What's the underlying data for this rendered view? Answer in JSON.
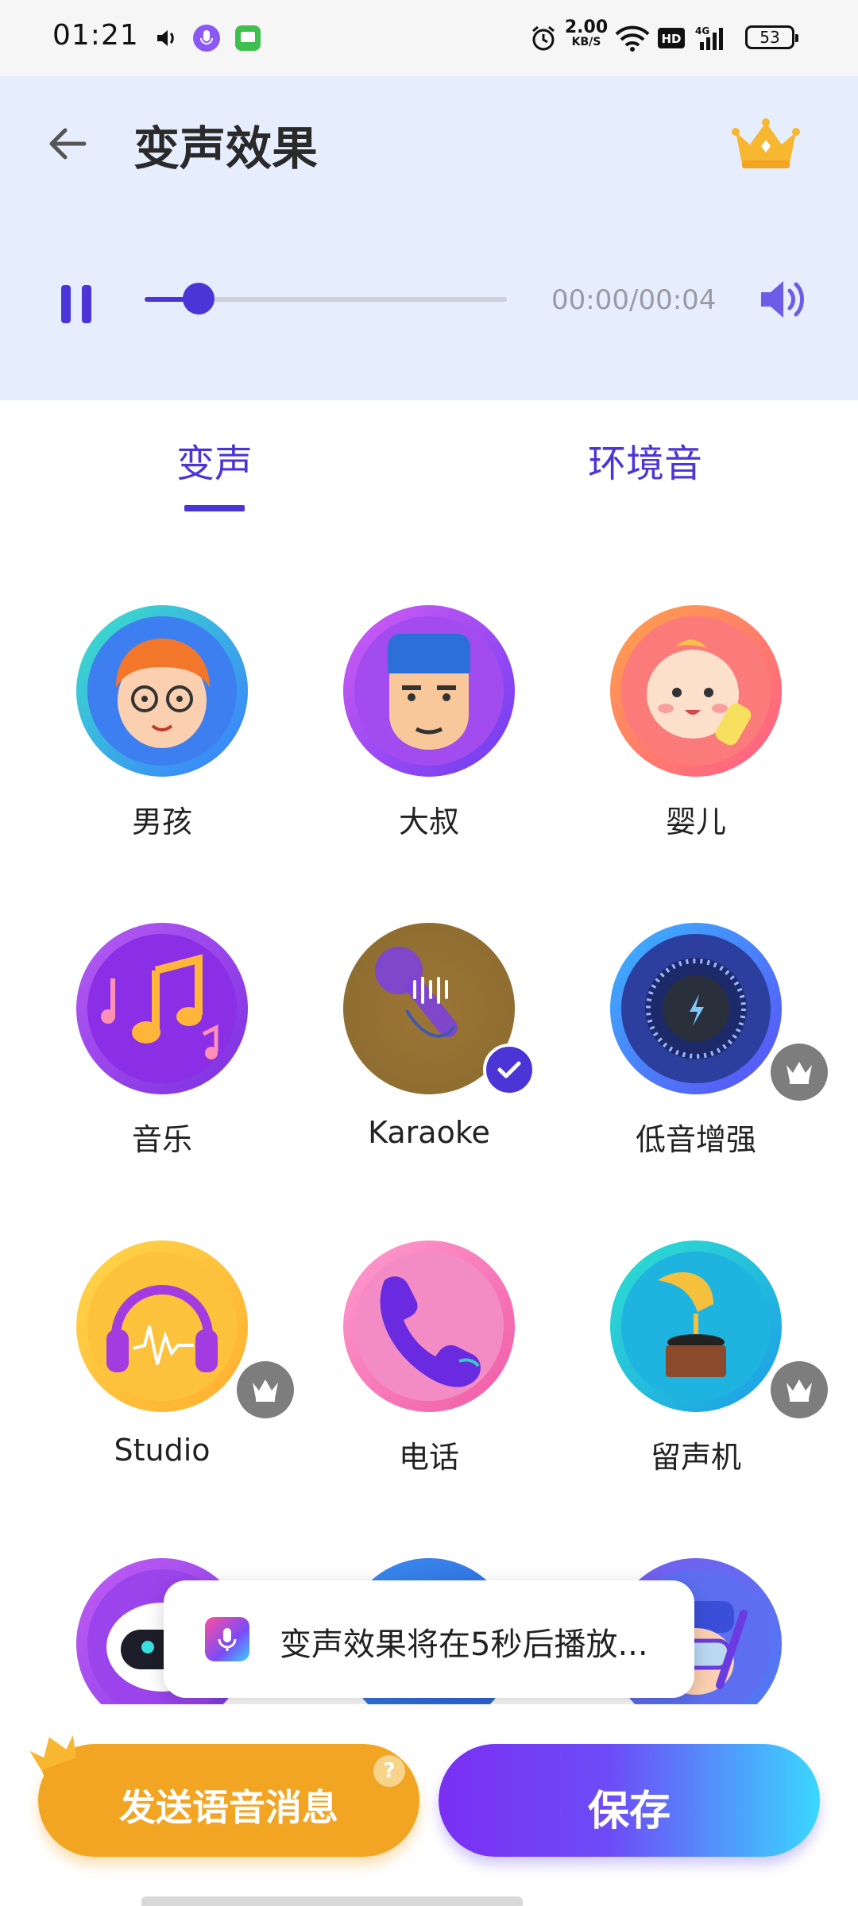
{
  "status_bar": {
    "time": "01:21",
    "net_speed_value": "2.00",
    "net_speed_unit": "KB/S",
    "battery": "53",
    "icons": [
      "volume-icon",
      "voice-app-icon",
      "message-app-icon",
      "alarm-icon",
      "wifi-icon",
      "hd-icon",
      "signal-4g-icon",
      "battery-icon"
    ]
  },
  "header": {
    "title": "变声效果",
    "back_icon": "arrow-left-icon",
    "vip_icon": "crown-icon",
    "player": {
      "state_icon": "pause-icon",
      "time": "00:00/00:04",
      "progress_fraction": 0.15,
      "volume_icon": "speaker-icon"
    }
  },
  "tabs": [
    {
      "label": "变声",
      "selected": true
    },
    {
      "label": "环境音",
      "selected": false
    }
  ],
  "effects": [
    {
      "label": "男孩",
      "icon": "boy-avatar-icon"
    },
    {
      "label": "大叔",
      "icon": "uncle-avatar-icon"
    },
    {
      "label": "婴儿",
      "icon": "baby-avatar-icon"
    },
    {
      "label": "音乐",
      "icon": "music-notes-icon"
    },
    {
      "label": "Karaoke",
      "icon": "microphone-icon",
      "selected": true
    },
    {
      "label": "低音增强",
      "icon": "bass-knob-icon",
      "vip": true
    },
    {
      "label": "Studio",
      "icon": "headphones-icon",
      "vip": true
    },
    {
      "label": "电话",
      "icon": "phone-icon"
    },
    {
      "label": "留声机",
      "icon": "gramophone-icon",
      "vip": true
    },
    {
      "label": "",
      "icon": "robot-avatar-icon"
    },
    {
      "label": "",
      "icon": "partial-avatar-icon"
    },
    {
      "label": "",
      "icon": "diver-avatar-icon"
    }
  ],
  "toast": {
    "text": "变声效果将在5秒后播放..."
  },
  "actions": {
    "send_label": "发送语音消息",
    "send_help": "?",
    "save_label": "保存"
  },
  "colors": {
    "accent": "#4b35d6",
    "header_bg": "#e6edfd",
    "send_orange": "#f2a423",
    "save_gradient_start": "#7a2ff3",
    "save_gradient_end": "#3ad7ff"
  }
}
